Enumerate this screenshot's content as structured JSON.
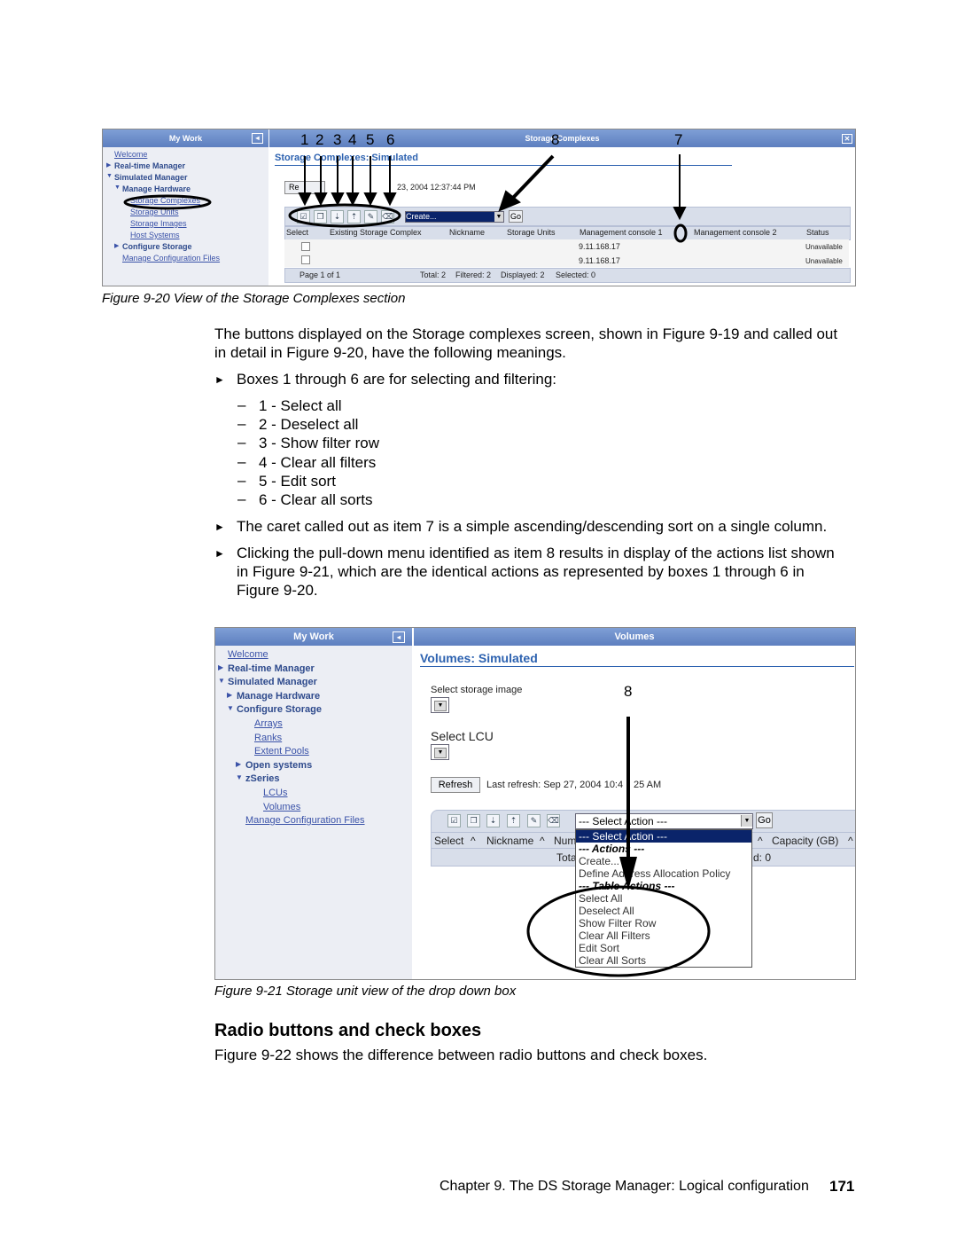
{
  "figure1": {
    "my_work": "My Work",
    "panel_title": "Storage Complexes",
    "nav": [
      {
        "label": "Welcome",
        "type": "link"
      },
      {
        "label": "Real-time Manager",
        "type": "node"
      },
      {
        "label": "Simulated Manager",
        "type": "node"
      },
      {
        "label": "Manage Hardware",
        "type": "node"
      },
      {
        "label": "Storage Complexes",
        "type": "link"
      },
      {
        "label": "Storage Units",
        "type": "link"
      },
      {
        "label": "Storage Images",
        "type": "link"
      },
      {
        "label": "Host Systems",
        "type": "link"
      },
      {
        "label": "Configure Storage",
        "type": "node"
      },
      {
        "label": "Manage Configuration Files",
        "type": "link"
      }
    ],
    "page_title": "Storage Complexes: Simulated",
    "refresh_label": "Re",
    "last_refresh": "23, 2004 12:37:44 PM",
    "action_select": "Create...",
    "go": "Go",
    "columns": [
      "Select",
      "Existing Storage Complex",
      "Nickname",
      "Storage Units",
      "Management console 1",
      "Management console 2",
      "Status"
    ],
    "rows": [
      {
        "mc1": "9.11.168.17",
        "status": "Unavailable"
      },
      {
        "mc1": "9.11.168.17",
        "status": "Unavailable"
      }
    ],
    "footer": {
      "page": "Page 1 of 1",
      "total": "Total: 2",
      "filtered": "Filtered: 2",
      "displayed": "Displayed: 2",
      "selected": "Selected: 0"
    },
    "callouts": [
      "1",
      "2",
      "3",
      "4",
      "5",
      "6",
      "7",
      "8"
    ],
    "caption": "Figure 9-20   View of the Storage Complexes section"
  },
  "body": {
    "intro1": "The buttons displayed on the Storage complexes screen, shown in Figure 9-19 and called out",
    "intro2": "in detail in Figure 9-20, have the following meanings.",
    "bullet1": "Boxes 1 through 6 are for selecting and filtering:",
    "sub": [
      "1 - Select all",
      "2 - Deselect all",
      "3 - Show filter row",
      "4 - Clear all filters",
      "5 - Edit sort",
      "6 - Clear all sorts"
    ],
    "bullet2": "The caret called out as item 7 is a simple ascending/descending sort on a single column.",
    "bullet3": [
      "Clicking the pull-down menu identified as item 8 results in display of the actions list shown",
      "in Figure 9-21, which are the identical actions as represented by boxes 1 through 6 in",
      "Figure 9-20."
    ]
  },
  "figure2": {
    "my_work": "My Work",
    "panel_title": "Volumes",
    "nav": [
      {
        "label": "Welcome",
        "type": "link"
      },
      {
        "label": "Real-time Manager",
        "type": "node"
      },
      {
        "label": "Simulated Manager",
        "type": "node"
      },
      {
        "label": "Manage Hardware",
        "type": "node"
      },
      {
        "label": "Configure Storage",
        "type": "node"
      },
      {
        "label": "Arrays",
        "type": "link"
      },
      {
        "label": "Ranks",
        "type": "link"
      },
      {
        "label": "Extent Pools",
        "type": "link"
      },
      {
        "label": "Open systems",
        "type": "node"
      },
      {
        "label": "zSeries",
        "type": "node"
      },
      {
        "label": "LCUs",
        "type": "link"
      },
      {
        "label": "Volumes",
        "type": "link"
      },
      {
        "label": "Manage Configuration Files",
        "type": "link"
      }
    ],
    "page_title": "Volumes: Simulated",
    "select_image_label": "Select storage image",
    "select_lcu_label": "Select LCU",
    "refresh": "Refresh",
    "last_refresh": "Last refresh: Sep 27, 2004 10:4",
    "last_refresh_tail": "25 AM",
    "action_select": "--- Select Action ---",
    "go": "Go",
    "columns": [
      "Select",
      "Nickname",
      "Num",
      "Capacity (GB)"
    ],
    "footer_total": "Tota",
    "footer_sel": "d: 0",
    "dropdown": {
      "highlighted": "--- Select Action ---",
      "group1": "--- Actions ---",
      "items1": [
        "Create...",
        "Define Address Allocation Policy"
      ],
      "group2": "--- Table Actions ---",
      "items2": [
        "Select All",
        "Deselect All",
        "Show Filter Row",
        "Clear All Filters",
        "Edit Sort",
        "Clear All Sorts"
      ]
    },
    "callout": "8",
    "caption": "Figure 9-21   Storage unit view of the drop down box"
  },
  "section": {
    "heading": "Radio buttons and check boxes",
    "text": "Figure 9-22 shows the difference between radio buttons and check boxes."
  },
  "footer": {
    "chapter": "Chapter 9. The DS Storage Manager: Logical configuration",
    "page": "171"
  },
  "colors": {
    "header_blue": "#6a8ccb",
    "link_blue": "#3a52a8",
    "title_blue": "#2d62b0",
    "highlight": "#0a246a"
  }
}
